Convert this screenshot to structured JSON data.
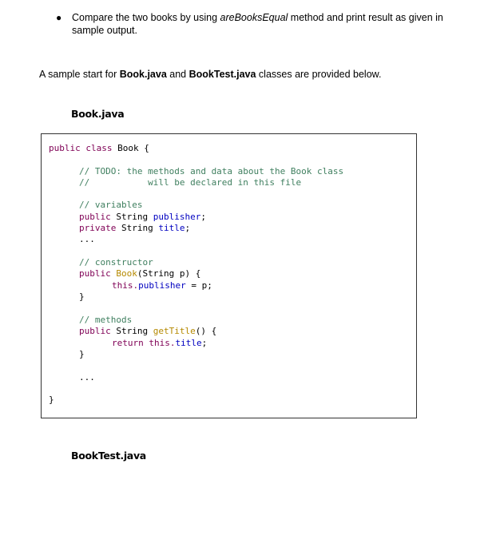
{
  "bullet": {
    "part1": "Compare the two books by using ",
    "method": "areBooksEqual",
    "part2": " method and print result as given in sample output."
  },
  "intro": {
    "part1": "A sample start for ",
    "file1": "Book.java",
    "and": " and ",
    "file2": "BookTest.java",
    "part2": " classes are provided below."
  },
  "headings": {
    "book": "Book.java",
    "booktest": "BookTest.java"
  },
  "code": {
    "class_kw": "public class",
    "class_name": " Book {",
    "todo1": "// TODO: the methods and data about the Book class",
    "todo2": "//           will be declared in this file",
    "vars_comment": "// variables",
    "var1_kw": "public",
    "var1_type": " String ",
    "var1_name": "publisher",
    "semi": ";",
    "var2_kw": "private",
    "var2_type": " String ",
    "var2_name": "title",
    "ellipsis": "...",
    "ctor_comment": "// constructor",
    "ctor_kw": "public",
    "ctor_name": " Book",
    "ctor_params": "(String p) {",
    "ctor_this": "this.",
    "ctor_field": "publisher",
    "ctor_assign": " = p;",
    "close": "}",
    "methods_comment": "// methods",
    "m_kw": "public",
    "m_type": " String ",
    "m_name": "getTitle",
    "m_params": "() {",
    "ret_kw": "return",
    "ret_this": " this.",
    "ret_field": "title",
    "ret_semi": ";"
  }
}
